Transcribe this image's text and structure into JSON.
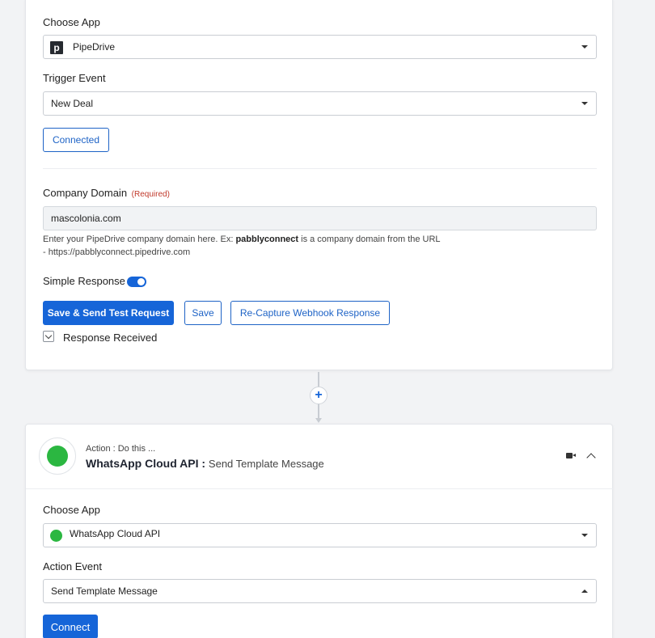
{
  "trigger": {
    "choose_app_label": "Choose App",
    "app_value": "PipeDrive",
    "app_icon": "pipedrive-logo",
    "trigger_event_label": "Trigger Event",
    "trigger_event_value": "New Deal",
    "connected_label": "Connected",
    "company_domain_label": "Company Domain",
    "required_tag": "(Required)",
    "company_domain_value": "mascolonia.com",
    "help_prefix": "Enter your PipeDrive company domain here. Ex: ",
    "help_bold": "pabblyconnect",
    "help_suffix": " is a company domain from the URL",
    "help_line2": "- https://pabblyconnect.pipedrive.com",
    "simple_response_label": "Simple Response",
    "simple_response_on": true,
    "save_send_label": "Save & Send Test Request",
    "save_label": "Save",
    "recapture_label": "Re-Capture Webhook Response",
    "response_received_label": "Response Received"
  },
  "connector": {
    "add_icon": "plus-icon",
    "add_glyph": "+"
  },
  "action": {
    "subtitle": "Action : Do this ...",
    "app_title": "WhatsApp Cloud API :",
    "event_title": "Send Template Message",
    "choose_app_label": "Choose App",
    "app_value": "WhatsApp Cloud API",
    "app_icon": "whatsapp-logo",
    "action_event_label": "Action Event",
    "action_event_value": "Send Template Message",
    "connect_label": "Connect"
  },
  "colors": {
    "primary": "#1665d8",
    "required": "#c0392b",
    "whatsapp": "#2bb741"
  }
}
